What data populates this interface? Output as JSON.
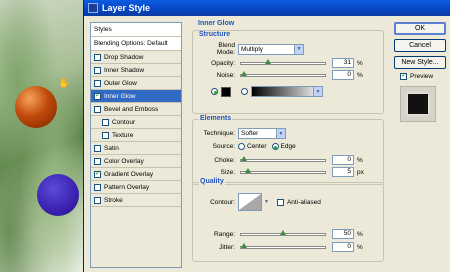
{
  "window": {
    "title": "Layer Style"
  },
  "styles_list": {
    "items": [
      {
        "label": "Styles",
        "type": "head"
      },
      {
        "label": "Blending Options: Default",
        "type": "head"
      },
      {
        "label": "Drop Shadow",
        "checked": false
      },
      {
        "label": "Inner Shadow",
        "checked": false
      },
      {
        "label": "Outer Glow",
        "checked": false
      },
      {
        "label": "Inner Glow",
        "checked": true,
        "selected": true
      },
      {
        "label": "Bevel and Emboss",
        "checked": false
      },
      {
        "label": "Contour",
        "checked": false,
        "sub": true
      },
      {
        "label": "Texture",
        "checked": false,
        "sub": true
      },
      {
        "label": "Satin",
        "checked": false
      },
      {
        "label": "Color Overlay",
        "checked": false
      },
      {
        "label": "Gradient Overlay",
        "checked": true
      },
      {
        "label": "Pattern Overlay",
        "checked": false
      },
      {
        "label": "Stroke",
        "checked": false
      }
    ]
  },
  "inner_glow": {
    "title": "Inner Glow",
    "structure": {
      "title": "Structure",
      "blend_mode_label": "Blend Mode:",
      "blend_mode_value": "Multiply",
      "opacity_label": "Opacity:",
      "opacity_value": "31",
      "noise_label": "Noise:",
      "noise_value": "0",
      "percent": "%",
      "color_swatch": "#000000"
    },
    "elements": {
      "title": "Elements",
      "technique_label": "Technique:",
      "technique_value": "Softer",
      "source_label": "Source:",
      "center_label": "Center",
      "edge_label": "Edge",
      "choke_label": "Choke:",
      "choke_value": "0",
      "size_label": "Size:",
      "size_value": "5",
      "px": "px",
      "percent": "%"
    },
    "quality": {
      "title": "Quality",
      "contour_label": "Contour:",
      "anti_aliased_label": "Anti-aliased",
      "range_label": "Range:",
      "range_value": "50",
      "jitter_label": "Jitter:",
      "jitter_value": "0",
      "percent": "%"
    }
  },
  "buttons": {
    "ok": "OK",
    "cancel": "Cancel",
    "new_style": "New Style...",
    "preview": "Preview"
  },
  "slider_levels": {
    "opacity": 0.31,
    "noise": 0,
    "choke": 0,
    "size": 0.05,
    "range": 0.5,
    "jitter": 0
  }
}
